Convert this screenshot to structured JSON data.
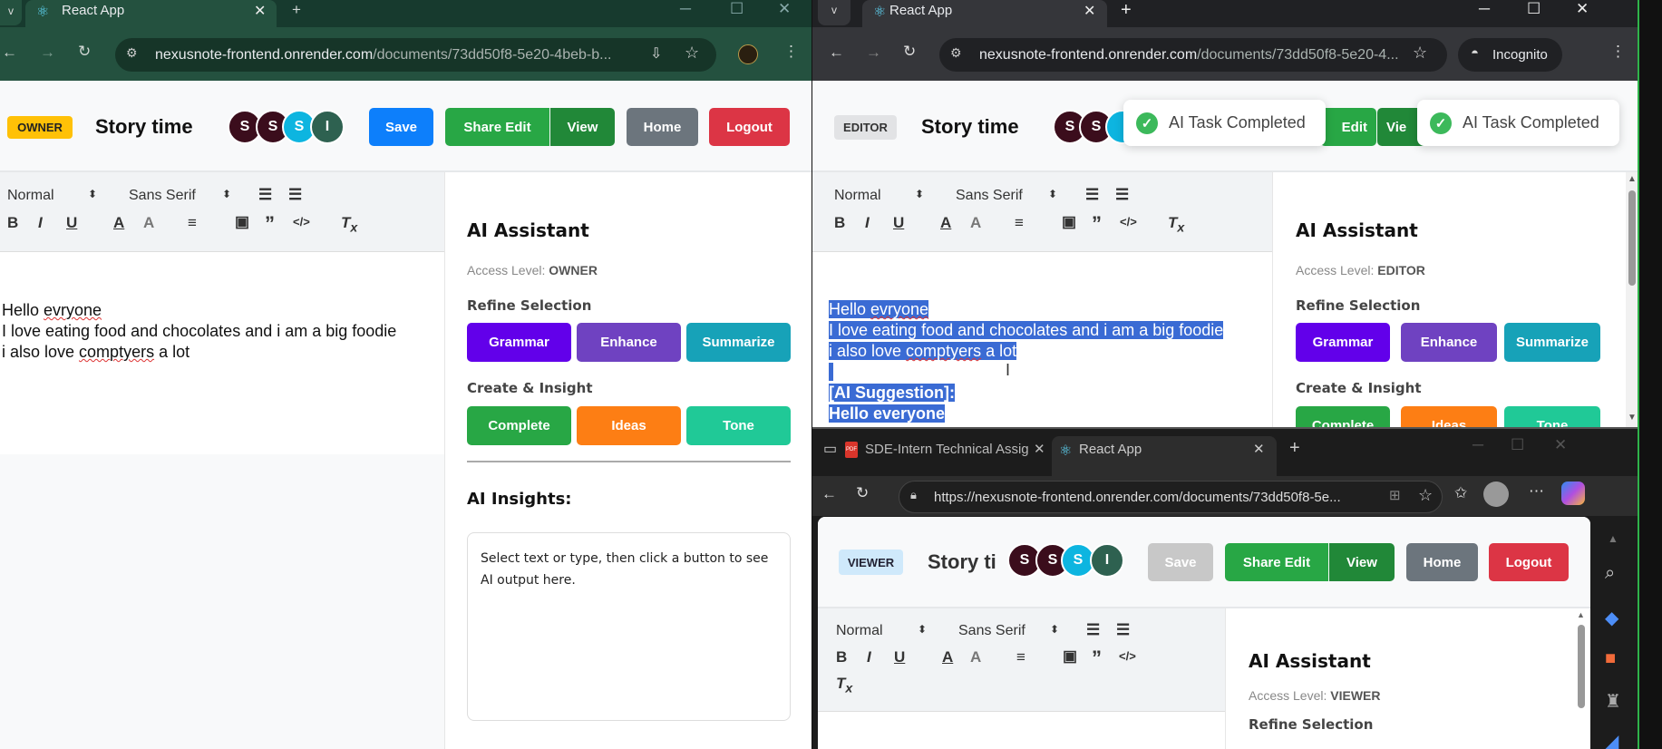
{
  "windows": {
    "owner": {
      "tab_title": "React App",
      "url_host": "nexusnote-frontend.onrender.com",
      "url_path": "/documents/73dd50f8-5e20-4beb-b...",
      "role_badge": "OWNER",
      "doc_title": "Story time",
      "avatars": [
        "S",
        "S",
        "S",
        "I"
      ],
      "buttons": {
        "save": "Save",
        "share_edit": "Share Edit",
        "view": "View",
        "home": "Home",
        "logout": "Logout"
      },
      "toolbar": {
        "heading": "Normal",
        "font": "Sans Serif"
      },
      "editor_lines": [
        "Hello ",
        "evryone",
        "I love eating food and chocolates and i am a big foodie",
        "i also love ",
        "comptyers",
        " a lot"
      ],
      "ai": {
        "title": "AI Assistant",
        "access_label": "Access Level:",
        "access_value": "OWNER",
        "refine": "Refine Selection",
        "grammar": "Grammar",
        "enhance": "Enhance",
        "summarize": "Summarize",
        "create": "Create & Insight",
        "complete": "Complete",
        "ideas": "Ideas",
        "tone": "Tone",
        "insights_title": "AI Insights:",
        "insights_text": "Select text or type, then click a button to see AI output here."
      }
    },
    "editor": {
      "tab_title": "React App",
      "url_host": "nexusnote-frontend.onrender.com",
      "url_path": "/documents/73dd50f8-5e20-4...",
      "incognito": "Incognito",
      "role_badge": "EDITOR",
      "doc_title": "Story time",
      "avatars": [
        "S",
        "S"
      ],
      "buttons": {
        "edit": "Edit",
        "view": "Vie"
      },
      "toasts": [
        "AI Task Completed",
        "AI Task Completed"
      ],
      "toolbar": {
        "heading": "Normal",
        "font": "Sans Serif"
      },
      "editor_lines": [
        "Hello ",
        "evryone",
        "I love eating food and chocolates and i am a big foodie",
        "i also love ",
        "comptyers",
        " a lot",
        "[AI Suggestion]:",
        "Hello everyone"
      ],
      "ai": {
        "title": "AI Assistant",
        "access_label": "Access Level:",
        "access_value": "EDITOR",
        "refine": "Refine Selection",
        "grammar": "Grammar",
        "enhance": "Enhance",
        "summarize": "Summarize",
        "create": "Create & Insight",
        "complete": "Complete",
        "ideas": "Ideas",
        "tone": "Tone"
      }
    },
    "viewer": {
      "tabs": [
        "SDE-Intern Technical Assignment",
        "React App"
      ],
      "url": "https://nexusnote-frontend.onrender.com/documents/73dd50f8-5e...",
      "role_badge": "VIEWER",
      "doc_title": "Story ti",
      "avatars": [
        "S",
        "S",
        "S",
        "I"
      ],
      "buttons": {
        "save": "Save",
        "share_edit": "Share Edit",
        "view": "View",
        "home": "Home",
        "logout": "Logout"
      },
      "toolbar": {
        "heading": "Normal",
        "font": "Sans Serif"
      },
      "ai": {
        "title": "AI Assistant",
        "access_label": "Access Level:",
        "access_value": "VIEWER",
        "refine": "Refine Selection"
      }
    }
  },
  "colors": {
    "owner_badge": "#ffc107",
    "editor_badge": "#e2e3e5",
    "viewer_badge": "#cfe9fb",
    "save": "#0d7ffb",
    "share_edit": "#28a745",
    "view": "#218838",
    "home": "#6c757d",
    "logout": "#dc3545",
    "grammar": "#6200ea",
    "enhance": "#6f42c1",
    "summarize": "#17a2b8",
    "complete": "#28a745",
    "ideas": "#fd7e14",
    "tone": "#20c997",
    "avatar_dark": "#3b0d1c",
    "avatar_cyan": "#0db5e0",
    "avatar_green": "#2e6150",
    "selection": "#3a6bd4",
    "toast_check": "#3cb95b"
  }
}
